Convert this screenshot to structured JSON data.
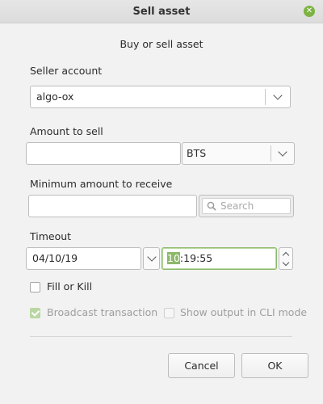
{
  "window": {
    "title": "Sell asset",
    "close_icon": "close-icon"
  },
  "header": {
    "subtitle": "Buy or sell asset"
  },
  "seller": {
    "label": "Seller account",
    "value": "algo-ox"
  },
  "amount": {
    "label": "Amount to sell",
    "value": "",
    "asset": "BTS"
  },
  "minimum": {
    "label": "Minimum amount to receive",
    "value": "",
    "search_placeholder": "Search"
  },
  "timeout": {
    "label": "Timeout",
    "date": "04/10/19",
    "time_hour": "10",
    "time_rest": ":19:55"
  },
  "options": {
    "fill_or_kill": {
      "label": "Fill or Kill",
      "checked": false
    },
    "broadcast": {
      "label": "Broadcast transaction",
      "checked": true,
      "enabled": false
    },
    "cli_mode": {
      "label": "Show output in CLI mode",
      "checked": false,
      "enabled": false
    }
  },
  "buttons": {
    "cancel": "Cancel",
    "ok": "OK"
  },
  "colors": {
    "accent": "#7cb342",
    "selection": "#8db86a"
  }
}
